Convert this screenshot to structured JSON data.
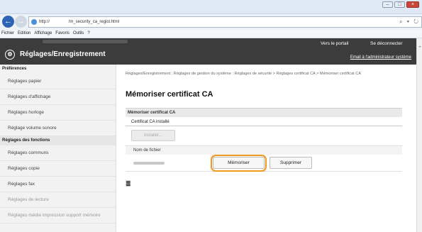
{
  "browser": {
    "url": "http://                /m_security_ca_regist.html",
    "tools": "⌕ ▾ ↻",
    "menu": [
      "Fichier",
      "Edition",
      "Affichage",
      "Favoris",
      "Outils",
      "?"
    ]
  },
  "header": {
    "title": "Réglages/Enregistrement",
    "portal_link": "Vers le portail",
    "logout_link": "Se déconnecter",
    "email_link": "Email à l'administrateur système"
  },
  "sidebar": {
    "preferences_heading": "Préférences",
    "preferences": [
      "Réglages papier",
      "Réglages d'affichage",
      "Réglages horloge",
      "Réglage volume sonore"
    ],
    "functions_heading": "Réglages des fonctions",
    "functions": [
      "Réglages communs",
      "Réglages copie",
      "Réglages fax",
      "Réglages de lecture",
      "Réglages média impression support mémoire"
    ]
  },
  "main": {
    "breadcrumb": "Réglages/Enregistrement : Réglages de gestion du système : Réglages de sécurité > Réglages certificat CA > Mémoriser certificat CA",
    "page_title": "Mémoriser certificat CA",
    "panel_title": "Mémoriser certificat CA",
    "installed_label": "Certificat CA installé",
    "install_button": "Installer...",
    "file_name_label": "Nom de fichier",
    "store_button": "Mémoriser",
    "delete_button": "Supprimer",
    "top_link": "≣"
  },
  "colors": {
    "header_bg": "#3c3c3c",
    "highlight": "#f29a1f",
    "nav_back": "#2d64b3"
  }
}
